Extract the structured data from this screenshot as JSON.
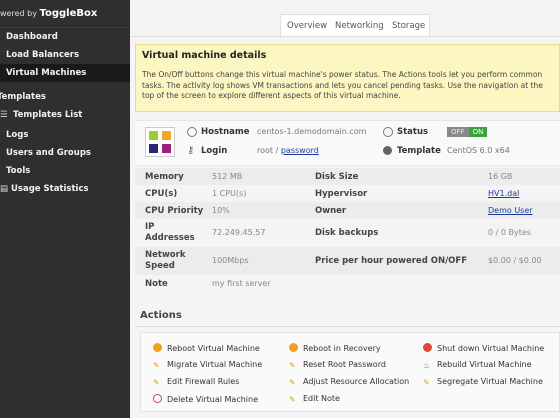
{
  "brand": {
    "prefix": "wered by",
    "name": "ToggleBox"
  },
  "sidebar": {
    "items": [
      {
        "label": "Dashboard"
      },
      {
        "label": "Load Balancers"
      },
      {
        "label": "Virtual Machines"
      },
      {
        "label": "Templates"
      },
      {
        "label": "Templates List"
      },
      {
        "label": "Logs"
      },
      {
        "label": "Users and Groups"
      },
      {
        "label": "Tools"
      },
      {
        "label": "Usage Statistics"
      }
    ]
  },
  "tabs": [
    "Overview",
    "Networking",
    "Storage"
  ],
  "notice": {
    "title": "Virtual machine details",
    "body": "The On/Off buttons change this virtual machine's power status. The Actions tools let you perform common tasks. The activity log shows VM transactions and lets you cancel pending tasks. Use the navigation at the top of the screen to explore different aspects of this virtual machine."
  },
  "summary": {
    "hostname_label": "Hostname",
    "hostname": "centos-1.demodomain.com",
    "login_label": "Login",
    "login_user": "root",
    "login_sep": "/",
    "login_pass": "password",
    "status_label": "Status",
    "status_off": "OFF",
    "status_on": "ON",
    "template_label": "Template",
    "template": "CentOS 6.0 x64"
  },
  "specs": {
    "memory_label": "Memory",
    "memory": "512 MB",
    "cpus_label": "CPU(s)",
    "cpus": "1 CPU(s)",
    "priority_label": "CPU Priority",
    "priority": "10%",
    "ip_label": "IP Addresses",
    "ip": "72.249.45.57",
    "net_label": "Network Speed",
    "net": "100Mbps",
    "note_label": "Note",
    "note": "my first server",
    "disk_label": "Disk Size",
    "disk": "16 GB",
    "hyper_label": "Hypervisor",
    "hyper": "HV1.dal",
    "owner_label": "Owner",
    "owner": "Demo User",
    "backups_label": "Disk backups",
    "backups": "0 / 0 Bytes",
    "price_label": "Price per hour powered ON/OFF",
    "price": "$0.00 / $0.00"
  },
  "actions": {
    "title": "Actions",
    "items": [
      "Reboot Virtual Machine",
      "Reboot in Recovery",
      "Shut down Virtual Machine",
      "Migrate Virtual Machine",
      "Reset Root Password",
      "Rebuild Virtual Machine",
      "Edit Firewall Rules",
      "Adjust Resource Allocation",
      "Segregate Virtual Machine",
      "Delete Virtual Machine",
      "Edit Note"
    ]
  }
}
